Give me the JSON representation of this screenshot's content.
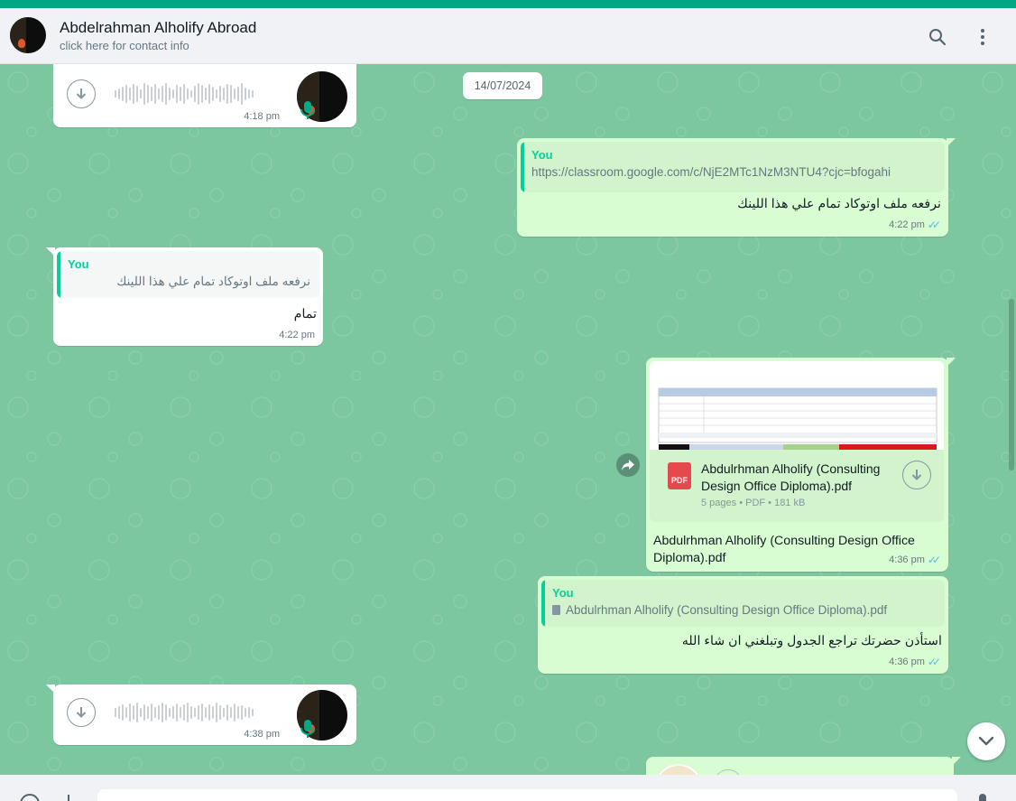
{
  "header": {
    "contact_name": "Abdelrahman Alholify Abroad",
    "contact_sub": "click here for contact info",
    "icons": [
      "search-icon",
      "menu-icon"
    ]
  },
  "colors": {
    "accent": "#00a884",
    "outgoing": "#d9fdd3",
    "incoming": "#ffffff",
    "chat_bg": "#7cc6a0",
    "tick_read": "#53bdeb",
    "quote_name": "#06cf9c"
  },
  "date_divider": "14/07/2024",
  "messages": {
    "voice1": {
      "time": "4:18 pm"
    },
    "link_msg": {
      "quote_author": "You",
      "quote_text": "https://classroom.google.com/c/NjE2MTc1NzM3NTU4?cjc=bfogahi",
      "text": "نرفعه ملف اوتوكاد تمام علي هذا اللينك",
      "time": "4:22 pm"
    },
    "reply_ok": {
      "quote_author": "You",
      "quote_text": "نرفعه ملف اوتوكاد تمام علي هذا اللينك",
      "text": "تمام",
      "time": "4:22 pm"
    },
    "pdf_msg": {
      "file_badge": "PDF",
      "file_name": "Abdulrhman Alholify (Consulting Design Office Diploma).pdf",
      "file_meta": "5 pages • PDF • 181 kB",
      "caption": "Abdulrhman Alholify (Consulting Design Office Diploma).pdf",
      "time": "4:36 pm"
    },
    "ask_msg": {
      "quote_author": "You",
      "quote_text": "Abdulrhman Alholify (Consulting Design Office Diploma).pdf",
      "text": "استأذن حضرتك تراجع الجدول وتبلغني ان شاء الله",
      "time": "4:36 pm"
    },
    "voice2": {
      "time": "4:38 pm"
    }
  }
}
